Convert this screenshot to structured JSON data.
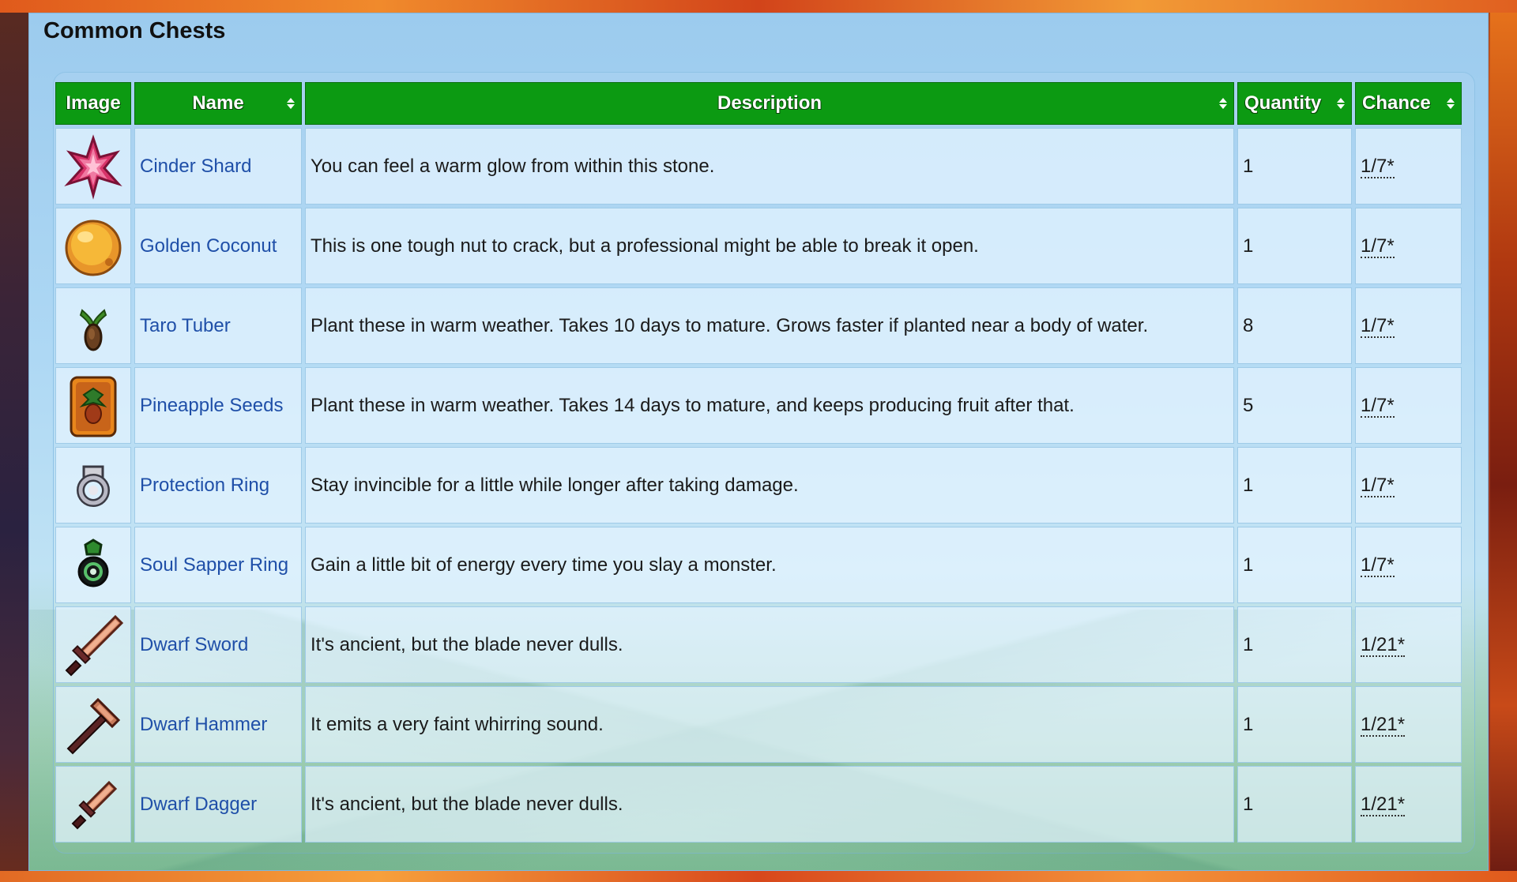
{
  "panel": {
    "title": "Common Chests"
  },
  "columns": {
    "image": "Image",
    "name": "Name",
    "description": "Description",
    "quantity": "Quantity",
    "chance": "Chance"
  },
  "rows": [
    {
      "icon": "cinder-shard-icon",
      "name": "Cinder Shard",
      "description": "You can feel a warm glow from within this stone.",
      "quantity": "1",
      "chance": "1/7*"
    },
    {
      "icon": "golden-coconut-icon",
      "name": "Golden Coconut",
      "description": "This is one tough nut to crack, but a professional might be able to break it open.",
      "quantity": "1",
      "chance": "1/7*"
    },
    {
      "icon": "taro-tuber-icon",
      "name": "Taro Tuber",
      "description": "Plant these in warm weather. Takes 10 days to mature. Grows faster if planted near a body of water.",
      "quantity": "8",
      "chance": "1/7*"
    },
    {
      "icon": "pineapple-seeds-icon",
      "name": "Pineapple Seeds",
      "description": "Plant these in warm weather. Takes 14 days to mature, and keeps producing fruit after that.",
      "quantity": "5",
      "chance": "1/7*"
    },
    {
      "icon": "protection-ring-icon",
      "name": "Protection Ring",
      "description": "Stay invincible for a little while longer after taking damage.",
      "quantity": "1",
      "chance": "1/7*"
    },
    {
      "icon": "soul-sapper-ring-icon",
      "name": "Soul Sapper Ring",
      "description": "Gain a little bit of energy every time you slay a monster.",
      "quantity": "1",
      "chance": "1/7*"
    },
    {
      "icon": "dwarf-sword-icon",
      "name": "Dwarf Sword",
      "description": "It's ancient, but the blade never dulls.",
      "quantity": "1",
      "chance": "1/21*"
    },
    {
      "icon": "dwarf-hammer-icon",
      "name": "Dwarf Hammer",
      "description": "It emits a very faint whirring sound.",
      "quantity": "1",
      "chance": "1/21*"
    },
    {
      "icon": "dwarf-dagger-icon",
      "name": "Dwarf Dagger",
      "description": "It's ancient, but the blade never dulls.",
      "quantity": "1",
      "chance": "1/21*"
    }
  ],
  "colors": {
    "header_green": "#0c9a12",
    "link_blue": "#1f4fa8",
    "panel_sky": "#9ccbee"
  }
}
